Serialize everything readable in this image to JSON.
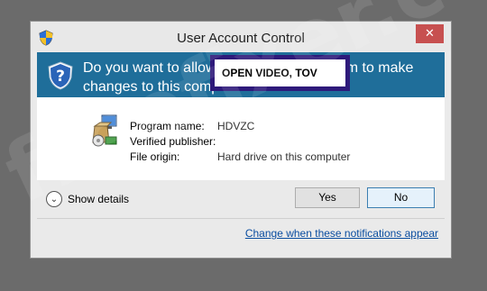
{
  "dialog": {
    "title": "User Account Control",
    "close_label": "✕",
    "banner_text": "Do you want to allow the following program to make changes to this computer?",
    "fields": [
      {
        "label": "Program name:",
        "value": "HDVZC"
      },
      {
        "label": "Verified publisher:",
        "value": ""
      },
      {
        "label": "File origin:",
        "value": "Hard drive on this computer"
      }
    ],
    "highlight_text": "OPEN VIDEO, TOV",
    "show_details_label": "Show details",
    "yes_label": "Yes",
    "no_label": "No",
    "notify_link": "Change when these notifications appear"
  },
  "watermark": "freefixer.com",
  "colors": {
    "banner": "#1f6e9a",
    "close": "#c75050",
    "highlight_border": "#2e1a7a",
    "link": "#0a4da0"
  },
  "icons": {
    "app": "shield-icon",
    "banner": "uac-shield-icon",
    "program": "installer-icon",
    "details": "chevron-down-icon"
  }
}
